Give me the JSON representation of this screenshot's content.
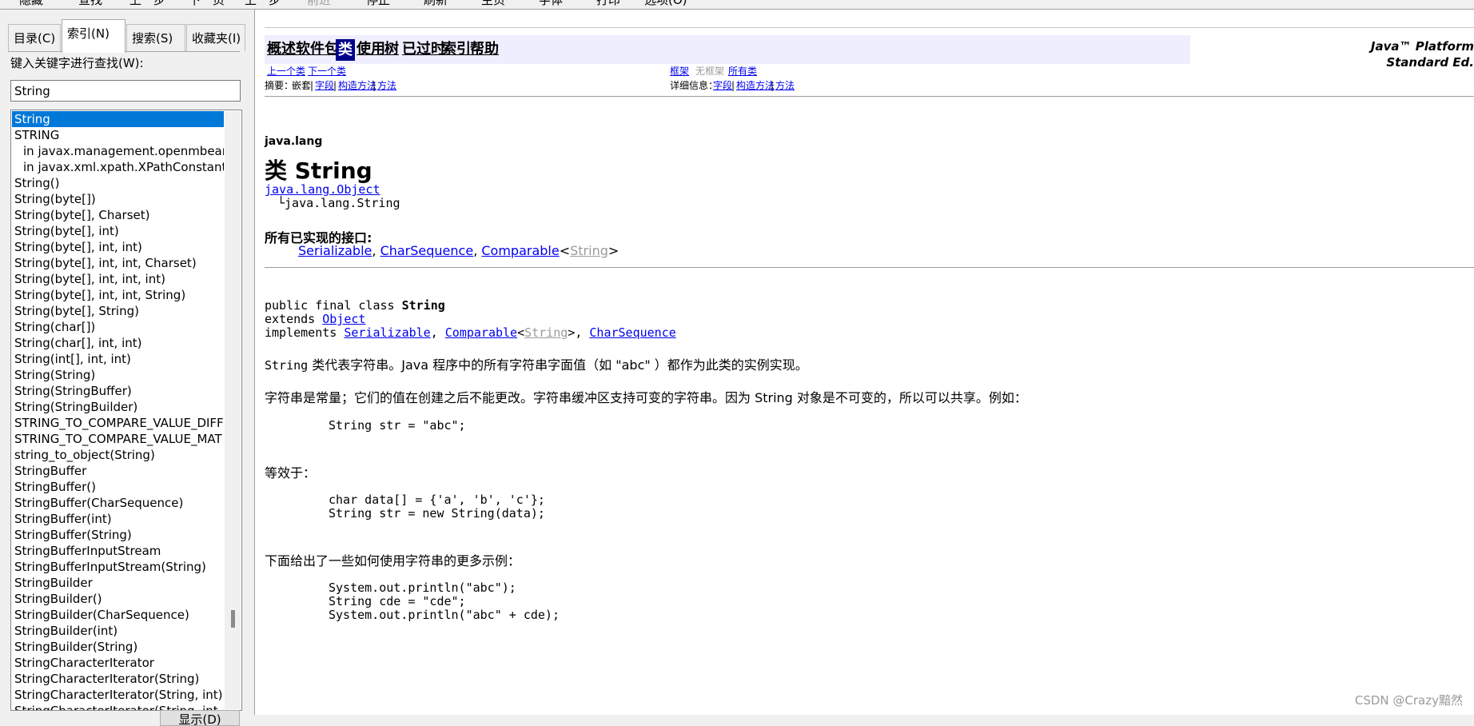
{
  "toolbar": {
    "items": [
      "隐藏",
      "查找",
      "上一步",
      "下一页",
      "上一步",
      "前进",
      "停止",
      "刷新",
      "主页",
      "字体",
      "打印",
      "选项(O)"
    ]
  },
  "left": {
    "tabs": [
      "目录(C)",
      "索引(N)",
      "搜索(S)",
      "收藏夹(I)"
    ],
    "keyword_label": "键入关键字进行查找(W):",
    "keyword_value": "String",
    "items": [
      "String",
      "STRING",
      "in javax.management.openmbean.",
      "in javax.xml.xpath.XPathConstants",
      "String()",
      "String(byte[])",
      "String(byte[], Charset)",
      "String(byte[], int)",
      "String(byte[], int, int)",
      "String(byte[], int, int, Charset)",
      "String(byte[], int, int, int)",
      "String(byte[], int, int, String)",
      "String(byte[], String)",
      "String(char[])",
      "String(char[], int, int)",
      "String(int[], int, int)",
      "String(String)",
      "String(StringBuffer)",
      "String(StringBuilder)",
      "STRING_TO_COMPARE_VALUE_DIFFI",
      "STRING_TO_COMPARE_VALUE_MAT",
      "string_to_object(String)",
      "StringBuffer",
      "StringBuffer()",
      "StringBuffer(CharSequence)",
      "StringBuffer(int)",
      "StringBuffer(String)",
      "StringBufferInputStream",
      "StringBufferInputStream(String)",
      "StringBuilder",
      "StringBuilder()",
      "StringBuilder(CharSequence)",
      "StringBuilder(int)",
      "StringBuilder(String)",
      "StringCharacterIterator",
      "StringCharacterIterator(String)",
      "StringCharacterIterator(String, int)",
      "StringCharacterIterator(String, int, int, int)"
    ],
    "display_button": "显示(D)"
  },
  "content": {
    "nav": [
      "概述",
      "软件包",
      "类",
      "使用",
      "树",
      "已过时",
      "索引",
      "帮助"
    ],
    "brand_line1": "Java™ Platform",
    "brand_line2": "Standard Ed.",
    "prev_class": "上一个类",
    "next_class": "下一个类",
    "frames": "框架",
    "no_frames": "无框架",
    "all_classes": "所有类",
    "summary_label": "摘要：",
    "summary_nested": "嵌套",
    "summary_field": "字段",
    "summary_constr": "构造方法",
    "summary_method": "方法",
    "detail_label": "详细信息：",
    "detail_field": "字段",
    "detail_constr": "构造方法",
    "detail_method": "方法",
    "sep": "|",
    "package": "java.lang",
    "class_title": "类 String",
    "hier_parent": "java.lang.Object",
    "hier_child": "└java.lang.String",
    "interfaces_heading": "所有已实现的接口:",
    "iface_serializable": "Serializable",
    "iface_charseq": "CharSequence",
    "iface_comparable": "Comparable",
    "iface_string": "String",
    "comma": ",",
    "lt": "<",
    "gt": ">",
    "decl_line1": "public final class ",
    "decl_class": "String",
    "decl_extends": "extends ",
    "decl_object": "Object",
    "decl_implements": "implements ",
    "decl_sep1": ", ",
    "decl_lt": "<",
    "decl_gt_comma": ">, ",
    "desc1_code": "String",
    "desc1_text": " 类代表字符串。Java 程序中的所有字符串字面值（如 \"abc\" ）都作为此类的实例实现。",
    "desc2": "字符串是常量；它们的值在创建之后不能更改。字符串缓冲区支持可变的字符串。因为 String 对象是不可变的，所以可以共享。例如：",
    "code1": "String str = \"abc\";",
    "equiv": "等效于：",
    "code2_l1": "char data[] = {'a', 'b', 'c'};",
    "code2_l2": "String str = new String(data);",
    "more_examples": "下面给出了一些如何使用字符串的更多示例：",
    "code3_l1": "System.out.println(\"abc\");",
    "code3_l2": "String cde = \"cde\";",
    "code3_l3": "System.out.println(\"abc\" + cde);"
  },
  "watermark": "CSDN @Crazy黯然"
}
